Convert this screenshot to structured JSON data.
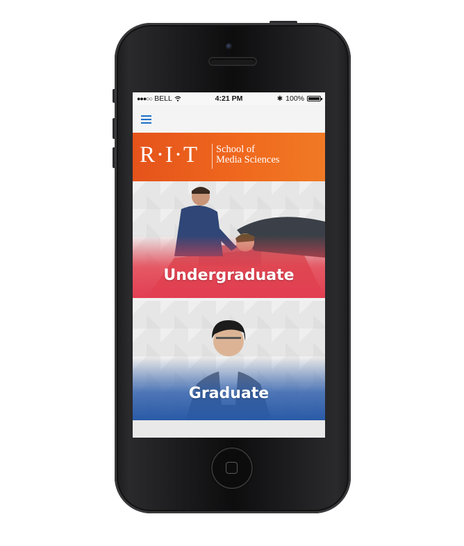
{
  "status_bar": {
    "signal": "●●●○○",
    "carrier": "BELL",
    "time": "4:21 PM",
    "battery": "100%",
    "icons": [
      "wifi-icon",
      "bluetooth-icon",
      "battery-icon"
    ]
  },
  "nav": {
    "menu_icon": "hamburger-menu-icon"
  },
  "banner": {
    "logo_text": "R·I·T",
    "school_line1": "School of",
    "school_line2": "Media Sciences",
    "color": "#e5531b"
  },
  "tiles": [
    {
      "label": "Undergraduate",
      "accent": "#e23e52"
    },
    {
      "label": "Graduate",
      "accent": "#2a5aa6"
    }
  ]
}
